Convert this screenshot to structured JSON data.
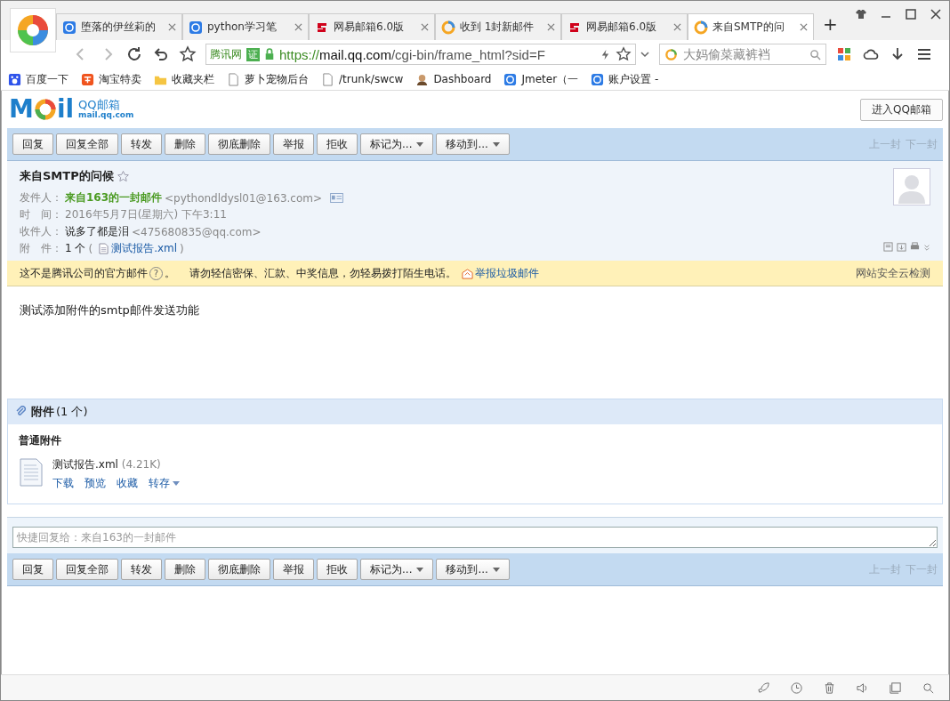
{
  "browser": {
    "tabs": [
      {
        "title": "堕落的伊丝莉的",
        "kind": "qq",
        "selected": false
      },
      {
        "title": "python学习笔",
        "kind": "qq",
        "selected": false
      },
      {
        "title": "网易邮箱6.0版",
        "kind": "netease",
        "selected": false
      },
      {
        "title": "收到 1封新邮件",
        "kind": "qqmail",
        "selected": false
      },
      {
        "title": "网易邮箱6.0版",
        "kind": "netease",
        "selected": false
      },
      {
        "title": "来自SMTP的问",
        "kind": "qqmail",
        "selected": true
      }
    ],
    "new_tab": "+",
    "address": {
      "site": "腾讯网",
      "cert": "证",
      "scheme": "https://",
      "host": "mail.qq.com",
      "path": "/cgi-bin/frame_html?sid=F"
    },
    "search": {
      "placeholder": "大妈偷菜藏裤裆"
    },
    "bookmarks": [
      {
        "label": "百度一下",
        "kind": "paw"
      },
      {
        "label": "淘宝特卖",
        "kind": "tao"
      },
      {
        "label": "收藏夹栏",
        "kind": "folder"
      },
      {
        "label": "萝卜宠物后台",
        "kind": "page"
      },
      {
        "label": "/trunk/swcw",
        "kind": "page"
      },
      {
        "label": "Dashboard",
        "kind": "person"
      },
      {
        "label": "Jmeter（一",
        "kind": "qq"
      },
      {
        "label": "账户设置 -",
        "kind": "qq"
      }
    ]
  },
  "mail": {
    "logo": {
      "first": "M",
      "rest": "il",
      "name": "QQ邮箱",
      "domain": "mail.qq.com"
    },
    "enter_button": "进入QQ邮箱",
    "toolbar": [
      {
        "label": "回复",
        "dropdown": false
      },
      {
        "label": "回复全部",
        "dropdown": false
      },
      {
        "label": "转发",
        "dropdown": false
      },
      {
        "label": "删除",
        "dropdown": false
      },
      {
        "label": "彻底删除",
        "dropdown": false
      },
      {
        "label": "举报",
        "dropdown": false
      },
      {
        "label": "拒收",
        "dropdown": false
      },
      {
        "label": "标记为...",
        "dropdown": true
      },
      {
        "label": "移动到...",
        "dropdown": true
      }
    ],
    "nav": [
      {
        "label": "上一封",
        "disabled": true
      },
      {
        "label": "下一封",
        "disabled": true
      }
    ],
    "subject": "来自SMTP的问候",
    "starred": false,
    "sender": {
      "label": "发件人：",
      "name": "来自163的一封邮件",
      "address": "<pythondldysl01@163.com>"
    },
    "time": {
      "label": "时　间：",
      "value": "2016年5月7日(星期六) 下午3:11"
    },
    "recipient": {
      "label": "收件人：",
      "name": "说多了都是泪",
      "address": "<475680835@qq.com>"
    },
    "attachment_line": {
      "label": "附　件：",
      "count": "1 个",
      "open": "(",
      "file": "测试报告.xml",
      "close": ")"
    },
    "warning": {
      "text": "这不是腾讯公司的官方邮件",
      "help": "?",
      "end": "。",
      "advice": "请勿轻信密保、汇款、中奖信息，勿轻易拨打陌生电话。",
      "report": "举报垃圾邮件",
      "check": "网站安全云检测"
    },
    "body": "测试添加附件的smtp邮件发送功能",
    "attachments": {
      "title": "附件",
      "count": "(1 个)",
      "section": "普通附件",
      "files": [
        {
          "name": "测试报告.xml",
          "size": "(4.21K)",
          "actions": [
            {
              "label": "下载",
              "dropdown": false
            },
            {
              "label": "预览",
              "dropdown": false
            },
            {
              "label": "收藏",
              "dropdown": false
            },
            {
              "label": "转存",
              "dropdown": true
            }
          ]
        }
      ]
    },
    "quick_reply": {
      "placeholder": "快捷回复给：来自163的一封邮件"
    },
    "bottom_toolbar": [
      {
        "label": "回复",
        "dropdown": false
      },
      {
        "label": "回复全部",
        "dropdown": false
      },
      {
        "label": "转发",
        "dropdown": false
      },
      {
        "label": "删除",
        "dropdown": false
      },
      {
        "label": "彻底删除",
        "dropdown": false
      },
      {
        "label": "举报",
        "dropdown": false
      },
      {
        "label": "拒收",
        "dropdown": false
      },
      {
        "label": "标记为...",
        "dropdown": true
      },
      {
        "label": "移动到...",
        "dropdown": true
      }
    ],
    "bottom_nav": [
      {
        "label": "上一封",
        "disabled": true
      },
      {
        "label": "下一封",
        "disabled": true
      }
    ]
  }
}
